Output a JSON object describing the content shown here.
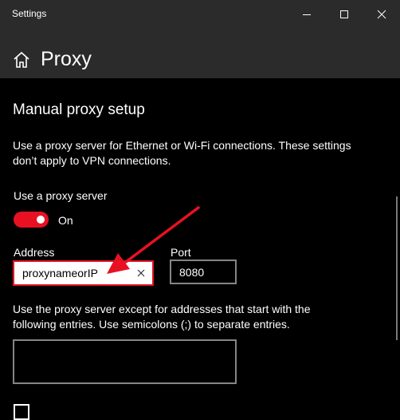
{
  "window": {
    "title": "Settings"
  },
  "header": {
    "title": "Proxy"
  },
  "section": {
    "title": "Manual proxy setup",
    "description_line1": "Use a proxy server for Ethernet or Wi-Fi connections. These settings",
    "description_line2": "don’t apply to VPN connections."
  },
  "use_proxy": {
    "label": "Use a proxy server",
    "state_label": "On",
    "enabled": true
  },
  "address": {
    "label": "Address",
    "value": "proxynameorIP"
  },
  "port": {
    "label": "Port",
    "value": "8080"
  },
  "exceptions": {
    "description_line1": "Use the proxy server except for addresses that start with the",
    "description_line2": "following entries. Use semicolons (;) to separate entries.",
    "value": ""
  },
  "icons": {
    "home": "home-icon",
    "minimize": "minimize-icon",
    "maximize": "maximize-icon",
    "close": "close-icon",
    "clear": "clear-icon",
    "annotation": "red-arrow-annotation"
  },
  "colors": {
    "accent": "#e81123",
    "background": "#000000",
    "titlebar": "#2b2b2b",
    "text": "#ffffff",
    "input_border": "#858585"
  }
}
